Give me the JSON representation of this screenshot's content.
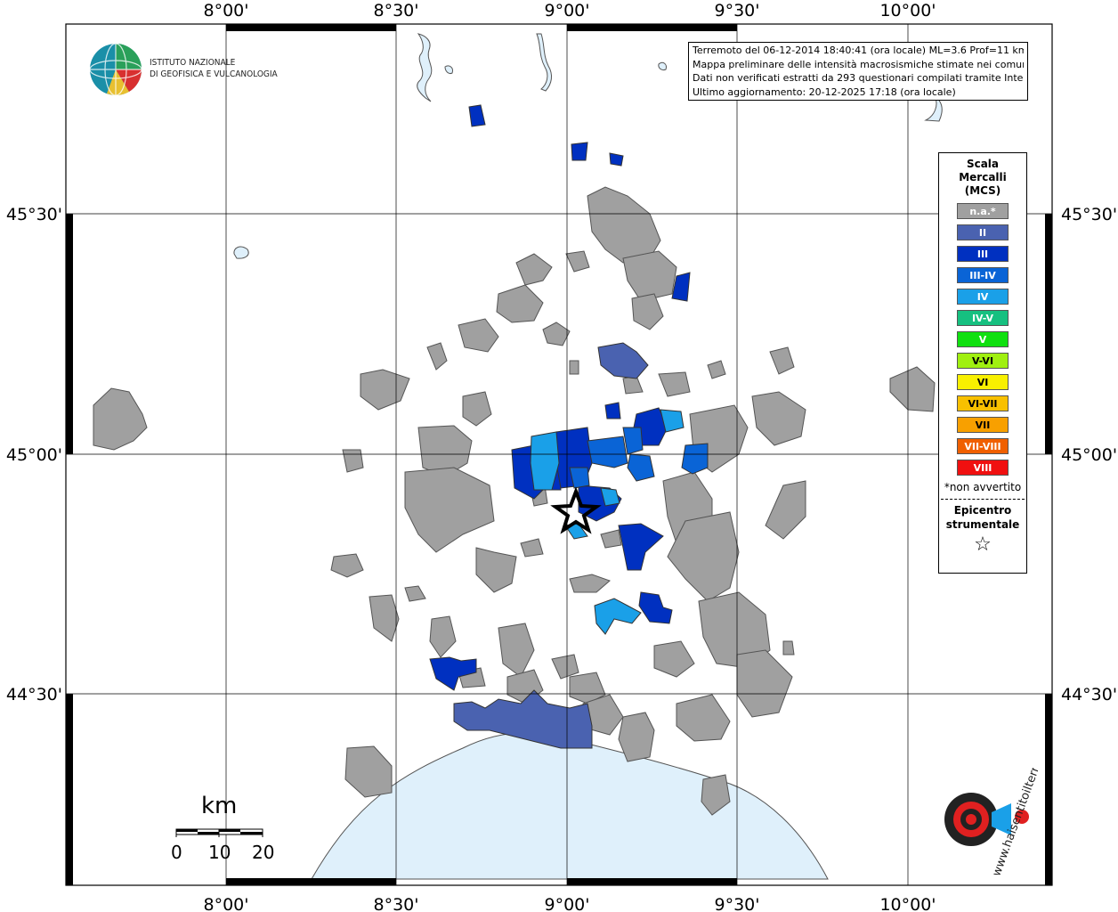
{
  "info_box": {
    "line1": "Terremoto del 06-12-2014 18:40:41 (ora locale) ML=3.6 Prof=11 km",
    "line2": "Mappa preliminare delle intensità macrosismiche stimate nei comuni",
    "line3": "Dati non verificati estratti da 293 questionari compilati tramite Internet.",
    "line4": "Ultimo aggiornamento: 20-12-2025 17:18 (ora locale)"
  },
  "logo": {
    "line1": "ISTITUTO NAZIONALE",
    "line2": "DI GEOFISICA E VULCANOLOGIA"
  },
  "legend": {
    "title1": "Scala",
    "title2": "Mercalli",
    "title3": "(MCS)",
    "items": [
      {
        "label": "n.a.*",
        "color": "#a0a0a0"
      },
      {
        "label": "II",
        "color": "#4a62b0"
      },
      {
        "label": "III",
        "color": "#0030c0"
      },
      {
        "label": "III-IV",
        "color": "#0a64d6"
      },
      {
        "label": "IV",
        "color": "#1aa0e8"
      },
      {
        "label": "IV-V",
        "color": "#16c080"
      },
      {
        "label": "V",
        "color": "#10e010"
      },
      {
        "label": "V-VI",
        "color": "#a0f010"
      },
      {
        "label": "VI",
        "color": "#f8f000"
      },
      {
        "label": "VI-VII",
        "color": "#f8c000"
      },
      {
        "label": "VII",
        "color": "#f8a000"
      },
      {
        "label": "VII-VIII",
        "color": "#f06000"
      },
      {
        "label": "VIII",
        "color": "#f01010"
      }
    ],
    "note": "*non avvertito",
    "epicentre1": "Epicentro",
    "epicentre2": "strumentale",
    "star": "☆"
  },
  "axes": {
    "top": [
      "8°00'",
      "8°30'",
      "9°00'",
      "9°30'",
      "10°00'"
    ],
    "bottom": [
      "8°00'",
      "8°30'",
      "9°00'",
      "9°30'",
      "10°00'"
    ],
    "left": [
      "45°30'",
      "45°00'",
      "44°30'"
    ],
    "right": [
      "45°30'",
      "45°00'",
      "44°30'"
    ]
  },
  "scale_bar": {
    "unit": "km",
    "labels": [
      "0",
      "10",
      "20"
    ]
  },
  "website_logo": {
    "text": "www.haisentitoilterremoto.it"
  },
  "colors": {
    "sea": "#dff0fb",
    "na": "#a0a0a0"
  }
}
